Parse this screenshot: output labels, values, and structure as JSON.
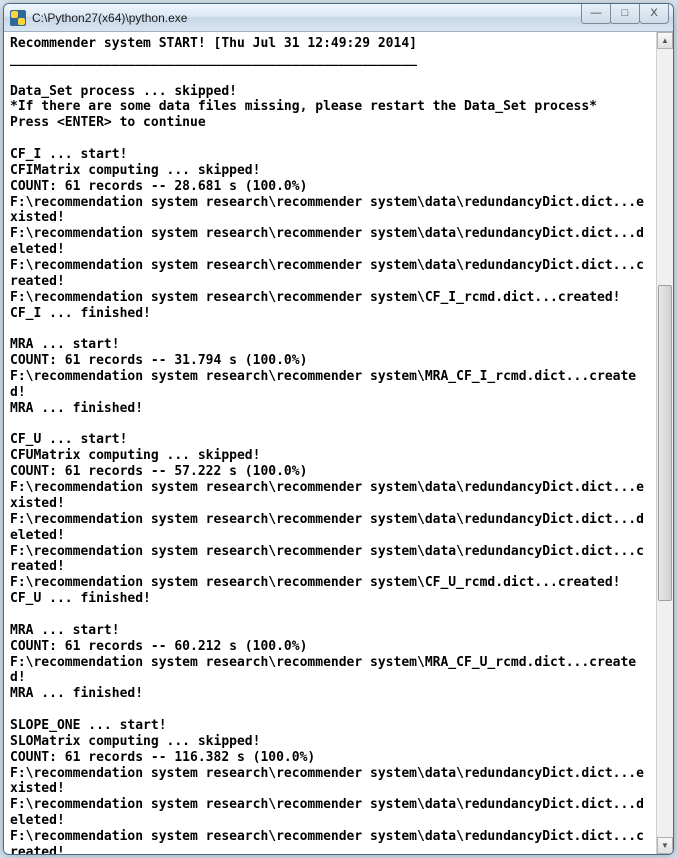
{
  "window": {
    "title": "C:\\Python27(x64)\\python.exe"
  },
  "controls": {
    "minimize": "—",
    "maximize": "□",
    "close": "X"
  },
  "scrollbar": {
    "up": "▲",
    "down": "▼"
  },
  "console": {
    "lines": [
      "Recommender system START! [Thu Jul 31 12:49:29 2014]",
      "____________________________________________________",
      "",
      "Data_Set process ... skipped!",
      "*If there are some data files missing, please restart the Data_Set process*",
      "Press <ENTER> to continue",
      "",
      "CF_I ... start!",
      "CFIMatrix computing ... skipped!",
      "COUNT: 61 records -- 28.681 s (100.0%)",
      "F:\\recommendation system research\\recommender system\\data\\redundancyDict.dict...existed!",
      "F:\\recommendation system research\\recommender system\\data\\redundancyDict.dict...deleted!",
      "F:\\recommendation system research\\recommender system\\data\\redundancyDict.dict...created!",
      "F:\\recommendation system research\\recommender system\\CF_I_rcmd.dict...created!",
      "CF_I ... finished!",
      "",
      "MRA ... start!",
      "COUNT: 61 records -- 31.794 s (100.0%)",
      "F:\\recommendation system research\\recommender system\\MRA_CF_I_rcmd.dict...created!",
      "MRA ... finished!",
      "",
      "CF_U ... start!",
      "CFUMatrix computing ... skipped!",
      "COUNT: 61 records -- 57.222 s (100.0%)",
      "F:\\recommendation system research\\recommender system\\data\\redundancyDict.dict...existed!",
      "F:\\recommendation system research\\recommender system\\data\\redundancyDict.dict...deleted!",
      "F:\\recommendation system research\\recommender system\\data\\redundancyDict.dict...created!",
      "F:\\recommendation system research\\recommender system\\CF_U_rcmd.dict...created!",
      "CF_U ... finished!",
      "",
      "MRA ... start!",
      "COUNT: 61 records -- 60.212 s (100.0%)",
      "F:\\recommendation system research\\recommender system\\MRA_CF_U_rcmd.dict...created!",
      "MRA ... finished!",
      "",
      "SLOPE_ONE ... start!",
      "SLOMatrix computing ... skipped!",
      "COUNT: 61 records -- 116.382 s (100.0%)",
      "F:\\recommendation system research\\recommender system\\data\\redundancyDict.dict...existed!",
      "F:\\recommendation system research\\recommender system\\data\\redundancyDict.dict...deleted!",
      "F:\\recommendation system research\\recommender system\\data\\redundancyDict.dict...created!"
    ]
  }
}
